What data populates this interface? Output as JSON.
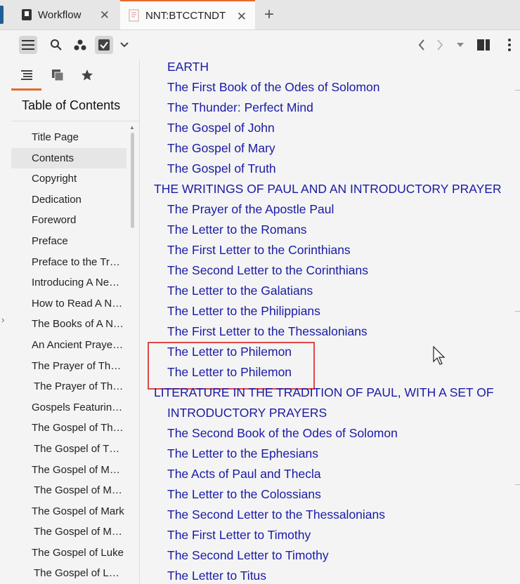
{
  "tabs": [
    {
      "label": "Workflow",
      "icon": "bookmark-icon"
    },
    {
      "label": "NNT:BTCCTNDT",
      "icon": "book-icon"
    }
  ],
  "toolbar": {
    "icons": [
      "menu-icon",
      "search-icon",
      "cluster-icon",
      "checklist-icon",
      "chevron-down-icon"
    ],
    "right_icons": [
      "back-icon",
      "forward-icon",
      "dropdown-icon",
      "layout-icon",
      "more-icon"
    ]
  },
  "sidebar": {
    "tabs": [
      "toc-icon",
      "copies-icon",
      "star-icon"
    ],
    "title": "Table of Contents",
    "items": [
      {
        "label": "Title Page",
        "indent": false,
        "selected": false
      },
      {
        "label": "Contents",
        "indent": false,
        "selected": true
      },
      {
        "label": "Copyright",
        "indent": false,
        "selected": false
      },
      {
        "label": "Dedication",
        "indent": false,
        "selected": false
      },
      {
        "label": "Foreword",
        "indent": false,
        "selected": false
      },
      {
        "label": "Preface",
        "indent": false,
        "selected": false
      },
      {
        "label": "Preface to the Tr…",
        "indent": false,
        "selected": false
      },
      {
        "label": "Introducing A Ne…",
        "indent": false,
        "selected": false
      },
      {
        "label": "How to Read A N…",
        "indent": false,
        "selected": false
      },
      {
        "label": "The Books of A N…",
        "indent": false,
        "selected": false
      },
      {
        "label": "An Ancient Praye…",
        "indent": false,
        "selected": false
      },
      {
        "label": "The Prayer of Th…",
        "indent": false,
        "selected": false
      },
      {
        "label": "The Prayer of Th…",
        "indent": true,
        "selected": false
      },
      {
        "label": "Gospels Featurin…",
        "indent": false,
        "selected": false
      },
      {
        "label": "The Gospel of Th…",
        "indent": false,
        "selected": false
      },
      {
        "label": "The Gospel of T…",
        "indent": true,
        "selected": false
      },
      {
        "label": "The Gospel of M…",
        "indent": false,
        "selected": false
      },
      {
        "label": "The Gospel of M…",
        "indent": true,
        "selected": false
      },
      {
        "label": "The Gospel of Mark",
        "indent": false,
        "selected": false
      },
      {
        "label": "The Gospel of M…",
        "indent": true,
        "selected": false
      },
      {
        "label": "The Gospel of Luke",
        "indent": false,
        "selected": false
      },
      {
        "label": "The Gospel of L…",
        "indent": true,
        "selected": false
      }
    ]
  },
  "content": {
    "lines": [
      {
        "text": "EARTH",
        "kind": "link"
      },
      {
        "text": "The First Book of the Odes of Solomon",
        "kind": "link"
      },
      {
        "text": "The Thunder: Perfect Mind",
        "kind": "link"
      },
      {
        "text": "The Gospel of John",
        "kind": "link"
      },
      {
        "text": "The Gospel of Mary",
        "kind": "link"
      },
      {
        "text": "The Gospel of Truth",
        "kind": "link"
      },
      {
        "text": "THE WRITINGS OF PAUL AND AN INTRODUCTORY PRAYER",
        "kind": "section"
      },
      {
        "text": "The Prayer of the Apostle Paul",
        "kind": "link"
      },
      {
        "text": "The Letter to the Romans",
        "kind": "link"
      },
      {
        "text": "The First Letter to the Corinthians",
        "kind": "link"
      },
      {
        "text": "The Second Letter to the Corinthians",
        "kind": "link"
      },
      {
        "text": "The Letter to the Galatians",
        "kind": "link"
      },
      {
        "text": "The Letter to the Philippians",
        "kind": "link"
      },
      {
        "text": "The First Letter to the Thessalonians",
        "kind": "link"
      },
      {
        "text": "The Letter to Philemon",
        "kind": "link"
      },
      {
        "text": "The Letter to Philemon",
        "kind": "link"
      },
      {
        "text": "LITERATURE IN THE TRADITION OF PAUL, WITH A SET OF",
        "kind": "section"
      },
      {
        "text": "INTRODUCTORY PRAYERS",
        "kind": "section-cont"
      },
      {
        "text": "The Second Book of the Odes of Solomon",
        "kind": "link"
      },
      {
        "text": "The Letter to the Ephesians",
        "kind": "link"
      },
      {
        "text": "The Acts of Paul and Thecla",
        "kind": "link"
      },
      {
        "text": "The Letter to the Colossians",
        "kind": "link"
      },
      {
        "text": "The Second Letter to the Thessalonians",
        "kind": "link"
      },
      {
        "text": "The First Letter to Timothy",
        "kind": "link"
      },
      {
        "text": "The Second Letter to Timothy",
        "kind": "link"
      },
      {
        "text": "The Letter to Titus",
        "kind": "link"
      }
    ]
  },
  "colors": {
    "link": "#1a1aa6",
    "accent": "#e46a2b",
    "highlight": "#e04646"
  }
}
